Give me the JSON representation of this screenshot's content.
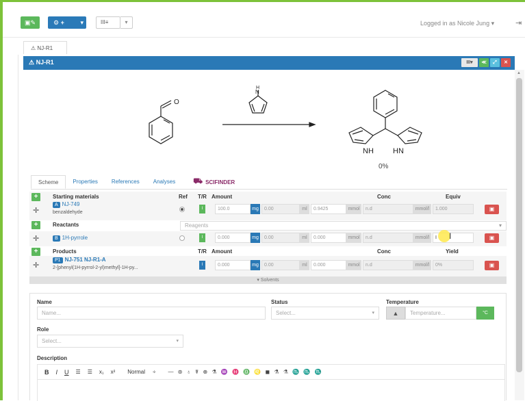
{
  "topbar": {
    "add_button_icon": "sample-edit-icon",
    "new_button_label": "+",
    "view_button_label": "III≡",
    "logged_in_text": "Logged in as Nicole Jung",
    "logout_icon": "logout-icon"
  },
  "tab": {
    "label": "NJ-R1"
  },
  "panel": {
    "title": "NJ-R1",
    "yield_text": "0%"
  },
  "detail_tabs": [
    "Scheme",
    "Properties",
    "References",
    "Analyses"
  ],
  "scifinder_label": "SCIFINDER",
  "table": {
    "starting": {
      "header": "Starting materials",
      "col_ref": "Ref",
      "col_tr": "T/R",
      "col_amount": "Amount",
      "col_conc": "Conc",
      "col_equiv": "Equiv",
      "tag": "A",
      "id": "NJ-749",
      "name": "benzaldehyde",
      "amount": "100.0",
      "amount_unit": "mg",
      "volume": "0.00",
      "volume_unit": "ml",
      "mmol": "0.9425",
      "mmol_unit": "mmol",
      "conc": "n.d",
      "conc_unit": "mmol/l",
      "equiv": "1.000",
      "tr": "I"
    },
    "reactants": {
      "header": "Reactants",
      "reagents_placeholder": "Reagents",
      "tag": "B",
      "name": "1H-pyrrole",
      "amount": "0.000",
      "amount_unit": "mg",
      "volume": "0.00",
      "volume_unit": "ml",
      "mmol": "0.000",
      "mmol_unit": "mmol",
      "conc": "n.d",
      "conc_unit": "mmol/l",
      "equiv": "I",
      "tr": "I"
    },
    "products": {
      "header": "Products",
      "col_tr": "T/R",
      "col_amount": "Amount",
      "col_conc": "Conc",
      "col_yield": "Yield",
      "tag": "P1",
      "id": "NJ-751 NJ-R1-A",
      "name": "2-[phenyl(1H-pyrrol-2-yl)methyl]-1H-py...",
      "amount": "0.000",
      "amount_unit": "mg",
      "volume": "0.00",
      "volume_unit": "ml",
      "mmol": "0.000",
      "mmol_unit": "mmol",
      "conc": "n.d",
      "conc_unit": "mmol/l",
      "yield": "0%",
      "tr": "I"
    },
    "solvents_label": "Solvents"
  },
  "form": {
    "name_label": "Name",
    "name_placeholder": "Name...",
    "status_label": "Status",
    "status_placeholder": "Select...",
    "temperature_label": "Temperature",
    "temperature_placeholder": "Temperature...",
    "temperature_unit": "°C",
    "role_label": "Role",
    "role_placeholder": "Select...",
    "description_label": "Description",
    "editor_style": "Normal"
  },
  "colors": {
    "primary": "#2a79b6",
    "success": "#5cb85c",
    "danger": "#d9534f",
    "frame": "#7dc23a"
  }
}
